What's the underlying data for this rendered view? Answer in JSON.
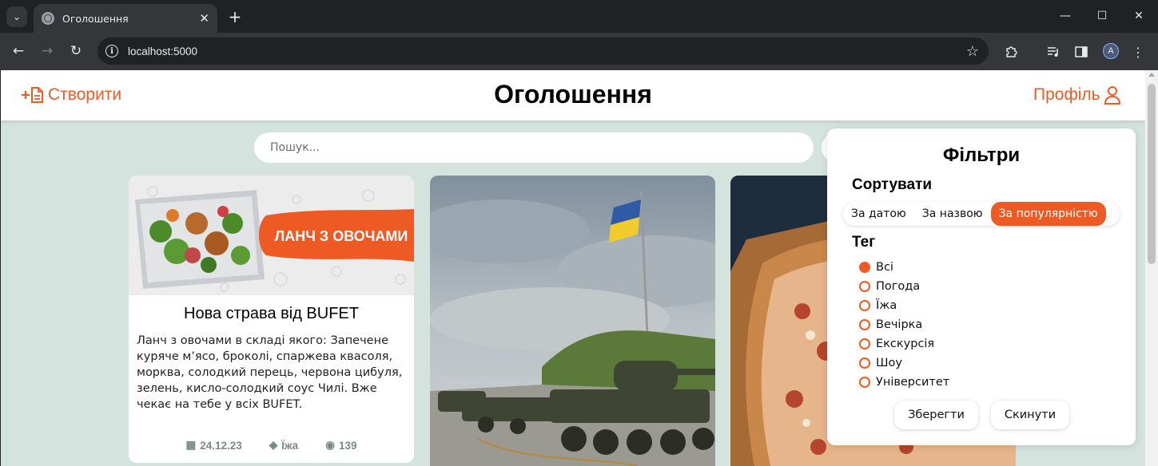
{
  "browser": {
    "tab_title": "Оголошення",
    "url": "localhost:5000",
    "profile_initial": "A"
  },
  "header": {
    "create_label": "Створити",
    "title": "Оголошення",
    "profile_label": "Профіль"
  },
  "search": {
    "placeholder": "Пошук..."
  },
  "cards": [
    {
      "image_text": "ЛАНЧ З ОВОЧАМИ",
      "title": "Нова страва від BUFET",
      "description": "Ланч з овочами в складі якого: Запечене куряче м’ясо, броколі, спаржева квасоля, морква, солодкий перець, червона цибуля, зелень, кисло-солодкий соус Чилі. Вже чекає на тебе у всіх BUFET.",
      "date": "24.12.23",
      "tag": "Їжа",
      "views": "139"
    },
    {},
    {}
  ],
  "filters": {
    "title": "Фільтри",
    "sort_heading": "Сортувати",
    "sort_options": [
      "За датою",
      "За назвою",
      "За популярністю"
    ],
    "sort_selected": "За популярністю",
    "tag_heading": "Тег",
    "tags": [
      "Всі",
      "Погода",
      "Їжа",
      "Вечірка",
      "Екскурсія",
      "Шоу",
      "Університет"
    ],
    "tag_selected": "Всі",
    "save_label": "Зберегти",
    "reset_label": "Скинути"
  },
  "colors": {
    "accent": "#ee5a24",
    "page_bg": "#d5e3de"
  }
}
